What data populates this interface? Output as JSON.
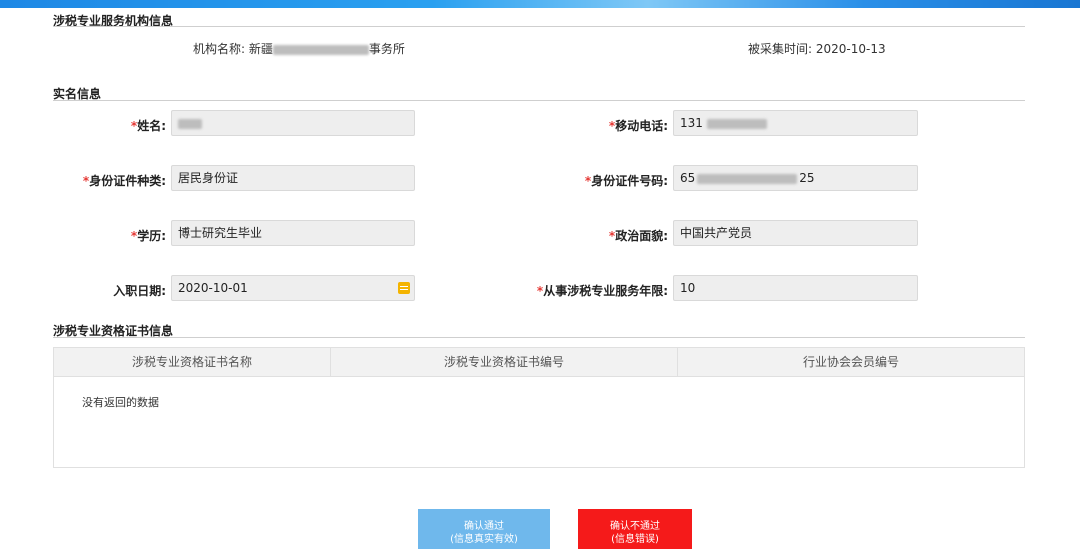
{
  "sections": {
    "agency": "涉税专业服务机构信息",
    "realname": "实名信息",
    "certs": "涉税专业资格证书信息"
  },
  "agency": {
    "name_label": "机构名称:",
    "name_prefix": "新疆",
    "name_suffix": "事务所",
    "collect_label": "被采集时间:",
    "collect_date": "2020-10-13"
  },
  "fields": {
    "name": {
      "label": "姓名:",
      "value": ""
    },
    "mobile": {
      "label": "移动电话:",
      "value": "131"
    },
    "id_type": {
      "label": "身份证件种类:",
      "value": "居民身份证"
    },
    "id_number": {
      "label": "身份证件号码:",
      "value_prefix": "65",
      "value_suffix": "25"
    },
    "education": {
      "label": "学历:",
      "value": "博士研究生毕业"
    },
    "political": {
      "label": "政治面貌:",
      "value": "中国共产党员"
    },
    "entry_date": {
      "label": "入职日期:",
      "value": "2020-10-01"
    },
    "service_years": {
      "label": "从事涉税专业服务年限:",
      "value": "10"
    }
  },
  "required_mark": "*",
  "table": {
    "columns": [
      "涉税专业资格证书名称",
      "涉税专业资格证书编号",
      "行业协会会员编号"
    ],
    "empty_text": "没有返回的数据"
  },
  "buttons": {
    "confirm_line1": "确认通过",
    "confirm_line2": "(信息真实有效)",
    "reject_line1": "确认不通过",
    "reject_line2": "(信息错误)"
  },
  "colors": {
    "confirm": "#6fb8ec",
    "reject": "#f51a1a",
    "required": "#e53935"
  }
}
